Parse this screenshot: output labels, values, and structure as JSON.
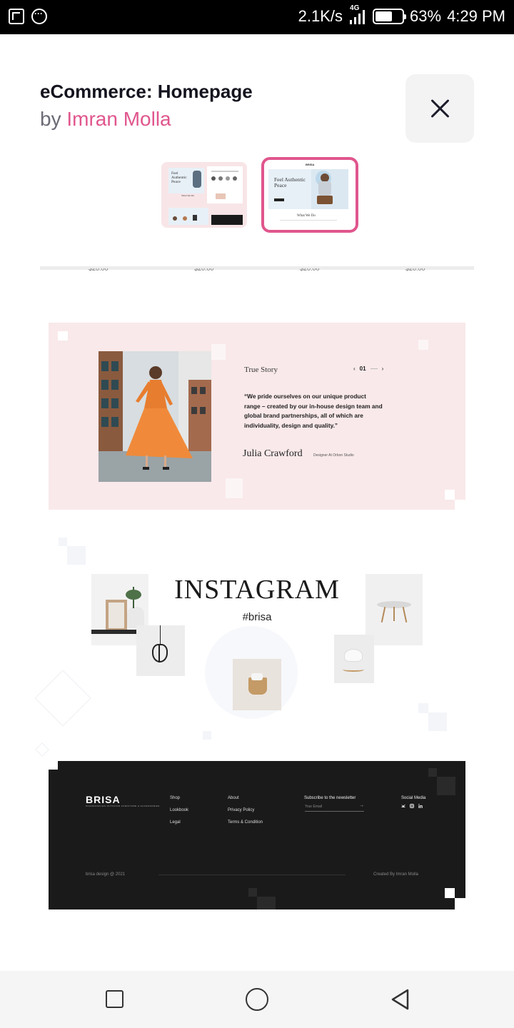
{
  "status_bar": {
    "speed": "2.1K/s",
    "network": "4G",
    "battery": "63%",
    "time": "4:29 PM",
    "battery_level": 0.63
  },
  "header": {
    "title": "eCommerce: Homepage",
    "by": "by",
    "author": "Imran Molla"
  },
  "thumbnails": {
    "thumb1": {
      "hero_text": "Feel Authentic Peace",
      "section_heading": "What We Do"
    },
    "thumb2": {
      "brand": "BRISA",
      "hero_text": "Feel Authentic Peace",
      "section_heading": "What We Do"
    }
  },
  "testimonial": {
    "title": "True Story",
    "prev": "‹",
    "index": "01",
    "next": "›",
    "quote": "“We pride ourselves on our unique product range – created by our in-house design team and global brand partnerships, all of which are individuality, design and quality.”",
    "name": "Julia Crawford",
    "role": "Designer At Orbon Studio"
  },
  "instagram": {
    "title": "INSTAGRAM",
    "hashtag": "#brisa"
  },
  "footer": {
    "logo": "BRISA",
    "logo_sub": "SCANDINAVIAN OUTDOOR FURNITURE & ACCESSORIES",
    "col1": [
      "Shop",
      "Lookbook",
      "Legal"
    ],
    "col2": [
      "About",
      "Privacy Policy",
      "Terms & Condition"
    ],
    "newsletter_heading": "Subscribe to the newsletter",
    "email_placeholder": "Your Email",
    "email_arrow": "→",
    "social_heading": "Social Media",
    "copyright": "brisa design @ 2021",
    "credit": "Created By Imran Molla"
  },
  "colors": {
    "accent": "#e0568d",
    "story_bg": "#f9e9ea",
    "footer_bg": "#1a1a1a"
  },
  "icons": {
    "status_left": [
      "screenshot-icon",
      "more-icon"
    ],
    "close": "close-icon",
    "nav": [
      "recents-icon",
      "home-icon",
      "back-icon"
    ]
  }
}
